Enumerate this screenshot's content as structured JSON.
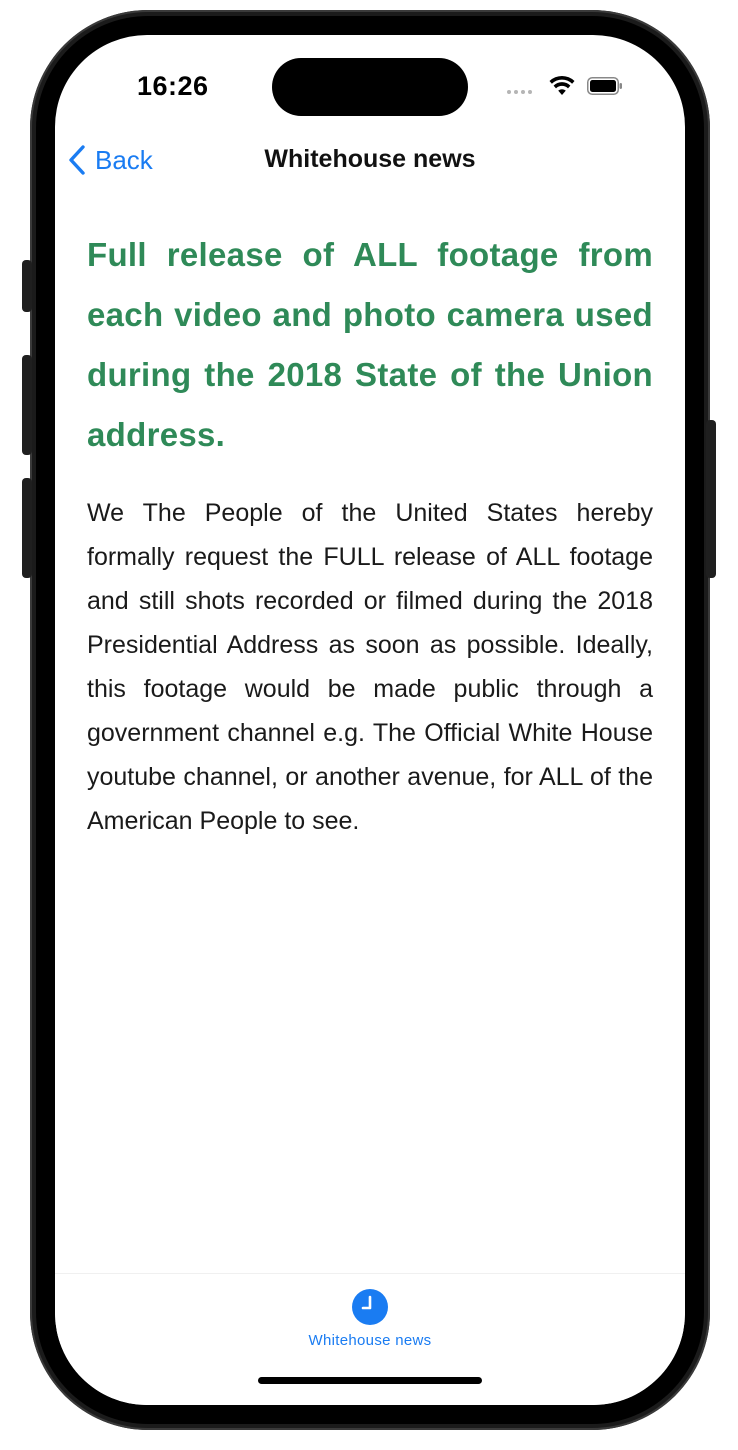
{
  "status_bar": {
    "time": "16:26",
    "signal_icon": "cellular-signal-icon",
    "wifi_icon": "wifi-icon",
    "battery_icon": "battery-icon"
  },
  "nav": {
    "back_label": "Back",
    "back_icon": "chevron-left-icon",
    "title": "Whitehouse news"
  },
  "article": {
    "headline": "Full release of ALL footage from each video and photo camera used during the 2018 State of the Union address.",
    "body": "We The People of the United States hereby formally request the FULL release of ALL footage and still shots recorded or filmed during the 2018 Presidential Address as soon as possible. Ideally, this footage would be made public through a government channel e.g. The Official White House youtube channel, or another avenue, for ALL of the American People to see."
  },
  "tab_bar": {
    "items": [
      {
        "label": "Whitehouse news",
        "icon": "clock-icon",
        "selected": true
      }
    ]
  },
  "colors": {
    "accent": "#1a7cf2",
    "headline": "#2f8a58",
    "text": "#1a1a1a"
  }
}
